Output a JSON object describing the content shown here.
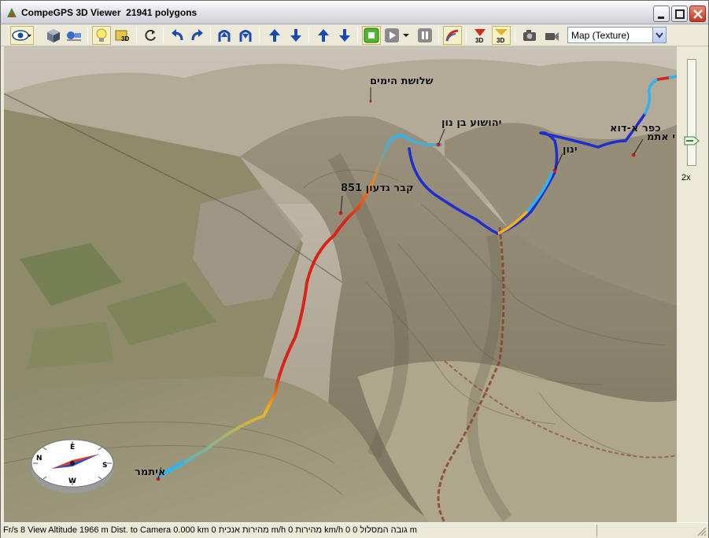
{
  "window": {
    "title": "CompeGPS 3D Viewer  21941 polygons"
  },
  "toolbar": {
    "map_layer_selected": "Map (Texture)",
    "buttons": [
      {
        "name": "view-eye-icon"
      },
      {
        "name": "cube-icon"
      },
      {
        "name": "camera-plane-icon"
      },
      {
        "name": "lightbulb-icon"
      },
      {
        "name": "3d-labels-icon"
      },
      {
        "name": "refresh-icon"
      },
      {
        "name": "rotate-left-icon"
      },
      {
        "name": "rotate-right-icon"
      },
      {
        "name": "tilt-up-icon"
      },
      {
        "name": "tilt-down-icon"
      },
      {
        "name": "move-up-icon"
      },
      {
        "name": "move-down-icon"
      },
      {
        "name": "altitude-up-icon"
      },
      {
        "name": "altitude-down-icon"
      },
      {
        "name": "stop-icon"
      },
      {
        "name": "play-icon"
      },
      {
        "name": "pause-icon"
      },
      {
        "name": "track-icon"
      },
      {
        "name": "3d-object-icon"
      },
      {
        "name": "3d-waypoint-icon"
      },
      {
        "name": "screenshot-camera-icon"
      },
      {
        "name": "video-camera-icon"
      }
    ]
  },
  "map_labels": [
    {
      "id": "sheloshet-hayamim",
      "text": "שלושת הימים"
    },
    {
      "id": "yehoshua-bin-nun",
      "text": "יהושוע בן נון"
    },
    {
      "id": "kfar-adua",
      "text": "כפר א-דוא"
    },
    {
      "id": "atar-edge",
      "text": "י אתמ"
    },
    {
      "id": "yanun",
      "text": "ינון"
    },
    {
      "id": "kever-gideon",
      "text": "קבר גדעון 851"
    },
    {
      "id": "itamar",
      "text": "איתמר"
    }
  ],
  "zoom": {
    "label": "2x"
  },
  "status": {
    "text": "Fr/s 8 View Altitude 1966 m Dist. to Camera 0.000 km 0 מהירות אנכית m/h 0 מהירות km/h 0 גובה המסלול 0 m"
  },
  "colors": {
    "track_slow": "#1e2fd0",
    "track_mid": "#2fb4f0",
    "track_warm": "#f2b31a",
    "track_fast": "#d8231b",
    "terrain_base": "#8d8570"
  }
}
